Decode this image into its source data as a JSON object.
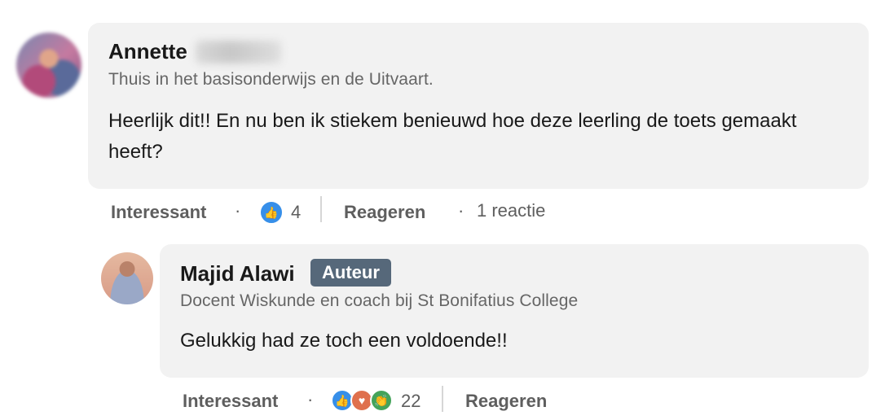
{
  "comment1": {
    "author_first_name": "Annette",
    "headline": "Thuis in het basisonderwijs en de Uitvaart.",
    "text": "Heerlijk dit!! En nu ben ik stiekem benieuwd hoe deze leerling de toets gemaakt heeft?",
    "actions": {
      "react_label": "Interessant",
      "reaction_count": "4",
      "reply_label": "Reageren",
      "reply_count_text": "1 reactie"
    }
  },
  "comment2": {
    "author_name": "Majid Alawi",
    "badge": "Auteur",
    "headline": "Docent Wiskunde en coach bij St Bonifatius College",
    "text": "Gelukkig had ze toch een voldoende!!",
    "actions": {
      "react_label": "Interessant",
      "reaction_count": "22",
      "reply_label": "Reageren"
    }
  },
  "separator": "·",
  "icons": {
    "like": "thumbs-up-icon",
    "love": "heart-icon",
    "celebrate": "clapping-hands-icon"
  },
  "colors": {
    "bubble": "#f2f2f2",
    "badge": "#56687a",
    "like": "#378fe9",
    "love": "#df704d",
    "celebrate": "#44a35a"
  }
}
